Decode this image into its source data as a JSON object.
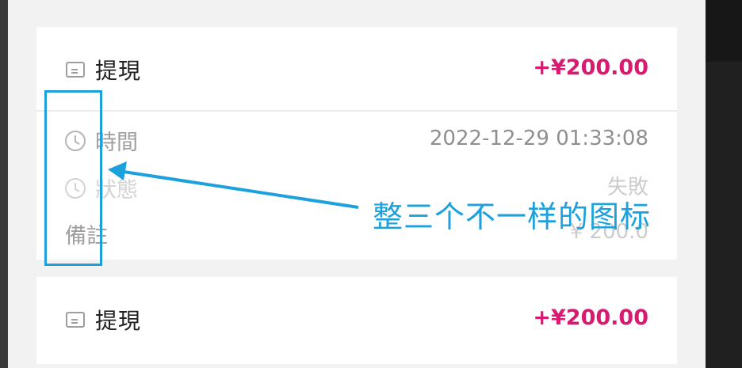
{
  "records": [
    {
      "title": "提現",
      "amount": "+¥200.00",
      "rows": [
        {
          "label": "時間",
          "value": "2022-12-29 01:33:08",
          "icon": "clock-icon"
        },
        {
          "label": "狀態",
          "value": "失敗",
          "icon": "clock-icon"
        },
        {
          "label": "備註",
          "value": "¥ 200.0",
          "icon": ""
        }
      ]
    },
    {
      "title": "提現",
      "amount": "+¥200.00"
    }
  ],
  "annotation": {
    "text": "整三个不一样的图标",
    "color": "#1da1dd"
  },
  "colors": {
    "amount": "#d81b70",
    "label": "#9e9e9e"
  }
}
